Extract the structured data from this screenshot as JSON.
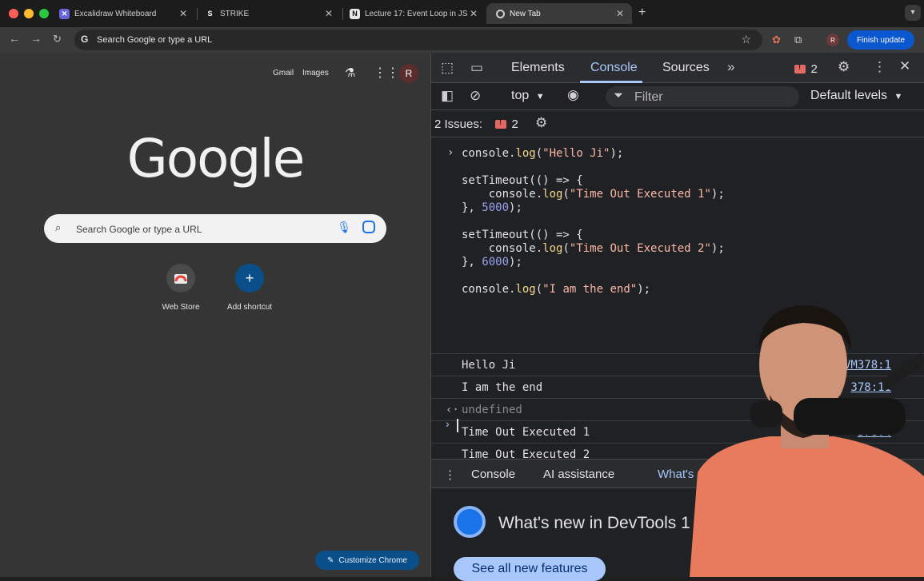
{
  "tabs": [
    {
      "title": "Excalidraw Whiteboard",
      "favicon": "excalidraw-icon"
    },
    {
      "title": "STRIKE",
      "favicon": "strike-icon"
    },
    {
      "title": "Lecture 17: Event Loop in JS",
      "favicon": "notion-icon"
    },
    {
      "title": "New Tab",
      "favicon": "chrome-icon"
    }
  ],
  "omnibox": {
    "placeholder": "Search Google or type a URL"
  },
  "toolbar": {
    "finish_update": "Finish update",
    "profile_initial": "R"
  },
  "ntp": {
    "links": [
      "Gmail",
      "Images"
    ],
    "avatar": "R",
    "logo": "Google",
    "search_placeholder": "Search Google or type a URL",
    "shortcuts": [
      {
        "label": "Web Store"
      },
      {
        "label": "Add shortcut"
      }
    ],
    "customize": "Customize Chrome"
  },
  "devtools": {
    "tabs": [
      "Elements",
      "Console",
      "Sources"
    ],
    "active_tab": "Console",
    "error_count": "2",
    "context": "top",
    "filter_placeholder": "Filter",
    "levels": "Default levels",
    "issues_label": "2 Issues:",
    "issues_count": "2",
    "code": {
      "l1_fn": "console.",
      "l1_m": "log",
      "l1_s": "\"Hello Ji\"",
      "l2": "setTimeout(() => {",
      "l3_s": "\"Time Out Executed 1\"",
      "l4_n": "5000",
      "l5": "setTimeout(() => {",
      "l6_s": "\"Time Out Executed 2\"",
      "l7_n": "6000",
      "l8_s": "\"I am the end\""
    },
    "output": [
      {
        "text": "Hello Ji",
        "source": "VM378:1"
      },
      {
        "text": "I am the end",
        "source": "378:11"
      },
      {
        "text": "undefined",
        "source": ""
      },
      {
        "text": "Time Out Executed 1",
        "source": "378:4"
      },
      {
        "text": "Time Out Executed 2",
        "source": ""
      }
    ],
    "drawer_tabs": [
      "Console",
      "AI assistance",
      "What's n"
    ],
    "whatsnew_title": "What's new in DevTools 1",
    "see_all": "See all new features"
  },
  "colors": {
    "accent": "#a8c7fa",
    "finish_update": "#0b57d0",
    "string": "#fcb8a8",
    "number": "#9aa0f0"
  }
}
